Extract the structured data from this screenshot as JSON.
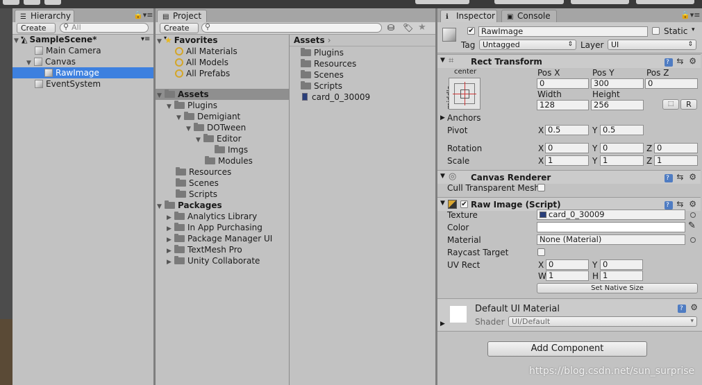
{
  "hierarchy": {
    "tab": "Hierarchy",
    "create": "Create",
    "search_placeholder": "All",
    "scene": "SampleScene*",
    "items": [
      "Main Camera",
      "Canvas",
      "RawImage",
      "EventSystem"
    ]
  },
  "project": {
    "tab": "Project",
    "create": "Create",
    "favorites_label": "Favorites",
    "favorites": [
      "All Materials",
      "All Models",
      "All Prefabs"
    ],
    "assets_label": "Assets",
    "tree": [
      "Plugins",
      "Demigiant",
      "DOTween",
      "Editor",
      "Imgs",
      "Modules",
      "Resources",
      "Scenes",
      "Scripts"
    ],
    "packages_label": "Packages",
    "packages": [
      "Analytics Library",
      "In App Purchasing",
      "Package Manager UI",
      "TextMesh Pro",
      "Unity Collaborate"
    ],
    "breadcrumb": "Assets",
    "contents": [
      "Plugins",
      "Resources",
      "Scenes",
      "Scripts",
      "card_0_30009"
    ]
  },
  "inspector": {
    "tab": "Inspector",
    "console_tab": "Console",
    "object_name": "RawImage",
    "static_label": "Static",
    "tag_label": "Tag",
    "tag_value": "Untagged",
    "layer_label": "Layer",
    "layer_value": "UI",
    "rect_transform": {
      "title": "Rect Transform",
      "anchor_h": "center",
      "anchor_v": "middle",
      "posx_label": "Pos X",
      "posy_label": "Pos Y",
      "posz_label": "Pos Z",
      "posx": "0",
      "posy": "300",
      "posz": "0",
      "width_label": "Width",
      "height_label": "Height",
      "width": "128",
      "height": "256",
      "r_button": "R",
      "anchors_label": "Anchors",
      "pivot_label": "Pivot",
      "pivot_x": "0.5",
      "pivot_y": "0.5",
      "rotation_label": "Rotation",
      "rot_x": "0",
      "rot_y": "0",
      "rot_z": "0",
      "scale_label": "Scale",
      "scale_x": "1",
      "scale_y": "1",
      "scale_z": "1",
      "x": "X",
      "y": "Y",
      "z": "Z"
    },
    "canvas_renderer": {
      "title": "Canvas Renderer",
      "cull_label": "Cull Transparent Mesh"
    },
    "raw_image": {
      "title": "Raw Image (Script)",
      "texture_label": "Texture",
      "texture_value": "card_0_30009",
      "color_label": "Color",
      "material_label": "Material",
      "material_value": "None (Material)",
      "raycast_label": "Raycast Target",
      "uvrect_label": "UV Rect",
      "uv_x": "0",
      "uv_y": "0",
      "uv_w": "1",
      "uv_h": "1",
      "w": "W",
      "h": "H",
      "native_button": "Set Native Size"
    },
    "material_preview": {
      "name": "Default UI Material",
      "shader_label": "Shader",
      "shader_value": "UI/Default"
    },
    "add_component": "Add Component"
  },
  "watermark": "https://blog.csdn.net/sun_surprise",
  "colors": {
    "selection": "#3d80df",
    "panel": "#c2c2c2",
    "accent_gold": "#d4a628"
  }
}
